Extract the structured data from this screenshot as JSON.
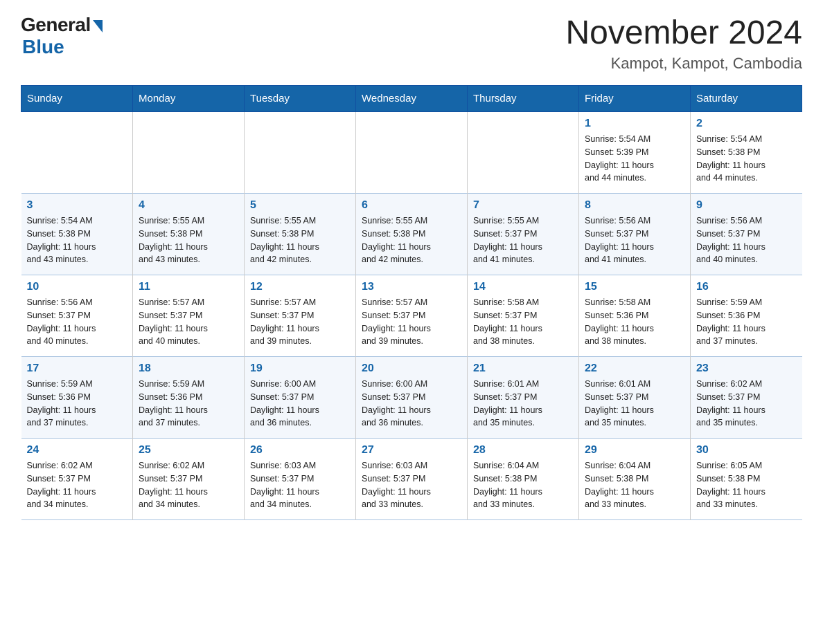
{
  "header": {
    "logo_general": "General",
    "logo_blue": "Blue",
    "main_title": "November 2024",
    "subtitle": "Kampot, Kampot, Cambodia"
  },
  "days_of_week": [
    "Sunday",
    "Monday",
    "Tuesday",
    "Wednesday",
    "Thursday",
    "Friday",
    "Saturday"
  ],
  "weeks": [
    [
      {
        "day": "",
        "info": ""
      },
      {
        "day": "",
        "info": ""
      },
      {
        "day": "",
        "info": ""
      },
      {
        "day": "",
        "info": ""
      },
      {
        "day": "",
        "info": ""
      },
      {
        "day": "1",
        "info": "Sunrise: 5:54 AM\nSunset: 5:39 PM\nDaylight: 11 hours\nand 44 minutes."
      },
      {
        "day": "2",
        "info": "Sunrise: 5:54 AM\nSunset: 5:38 PM\nDaylight: 11 hours\nand 44 minutes."
      }
    ],
    [
      {
        "day": "3",
        "info": "Sunrise: 5:54 AM\nSunset: 5:38 PM\nDaylight: 11 hours\nand 43 minutes."
      },
      {
        "day": "4",
        "info": "Sunrise: 5:55 AM\nSunset: 5:38 PM\nDaylight: 11 hours\nand 43 minutes."
      },
      {
        "day": "5",
        "info": "Sunrise: 5:55 AM\nSunset: 5:38 PM\nDaylight: 11 hours\nand 42 minutes."
      },
      {
        "day": "6",
        "info": "Sunrise: 5:55 AM\nSunset: 5:38 PM\nDaylight: 11 hours\nand 42 minutes."
      },
      {
        "day": "7",
        "info": "Sunrise: 5:55 AM\nSunset: 5:37 PM\nDaylight: 11 hours\nand 41 minutes."
      },
      {
        "day": "8",
        "info": "Sunrise: 5:56 AM\nSunset: 5:37 PM\nDaylight: 11 hours\nand 41 minutes."
      },
      {
        "day": "9",
        "info": "Sunrise: 5:56 AM\nSunset: 5:37 PM\nDaylight: 11 hours\nand 40 minutes."
      }
    ],
    [
      {
        "day": "10",
        "info": "Sunrise: 5:56 AM\nSunset: 5:37 PM\nDaylight: 11 hours\nand 40 minutes."
      },
      {
        "day": "11",
        "info": "Sunrise: 5:57 AM\nSunset: 5:37 PM\nDaylight: 11 hours\nand 40 minutes."
      },
      {
        "day": "12",
        "info": "Sunrise: 5:57 AM\nSunset: 5:37 PM\nDaylight: 11 hours\nand 39 minutes."
      },
      {
        "day": "13",
        "info": "Sunrise: 5:57 AM\nSunset: 5:37 PM\nDaylight: 11 hours\nand 39 minutes."
      },
      {
        "day": "14",
        "info": "Sunrise: 5:58 AM\nSunset: 5:37 PM\nDaylight: 11 hours\nand 38 minutes."
      },
      {
        "day": "15",
        "info": "Sunrise: 5:58 AM\nSunset: 5:36 PM\nDaylight: 11 hours\nand 38 minutes."
      },
      {
        "day": "16",
        "info": "Sunrise: 5:59 AM\nSunset: 5:36 PM\nDaylight: 11 hours\nand 37 minutes."
      }
    ],
    [
      {
        "day": "17",
        "info": "Sunrise: 5:59 AM\nSunset: 5:36 PM\nDaylight: 11 hours\nand 37 minutes."
      },
      {
        "day": "18",
        "info": "Sunrise: 5:59 AM\nSunset: 5:36 PM\nDaylight: 11 hours\nand 37 minutes."
      },
      {
        "day": "19",
        "info": "Sunrise: 6:00 AM\nSunset: 5:37 PM\nDaylight: 11 hours\nand 36 minutes."
      },
      {
        "day": "20",
        "info": "Sunrise: 6:00 AM\nSunset: 5:37 PM\nDaylight: 11 hours\nand 36 minutes."
      },
      {
        "day": "21",
        "info": "Sunrise: 6:01 AM\nSunset: 5:37 PM\nDaylight: 11 hours\nand 35 minutes."
      },
      {
        "day": "22",
        "info": "Sunrise: 6:01 AM\nSunset: 5:37 PM\nDaylight: 11 hours\nand 35 minutes."
      },
      {
        "day": "23",
        "info": "Sunrise: 6:02 AM\nSunset: 5:37 PM\nDaylight: 11 hours\nand 35 minutes."
      }
    ],
    [
      {
        "day": "24",
        "info": "Sunrise: 6:02 AM\nSunset: 5:37 PM\nDaylight: 11 hours\nand 34 minutes."
      },
      {
        "day": "25",
        "info": "Sunrise: 6:02 AM\nSunset: 5:37 PM\nDaylight: 11 hours\nand 34 minutes."
      },
      {
        "day": "26",
        "info": "Sunrise: 6:03 AM\nSunset: 5:37 PM\nDaylight: 11 hours\nand 34 minutes."
      },
      {
        "day": "27",
        "info": "Sunrise: 6:03 AM\nSunset: 5:37 PM\nDaylight: 11 hours\nand 33 minutes."
      },
      {
        "day": "28",
        "info": "Sunrise: 6:04 AM\nSunset: 5:38 PM\nDaylight: 11 hours\nand 33 minutes."
      },
      {
        "day": "29",
        "info": "Sunrise: 6:04 AM\nSunset: 5:38 PM\nDaylight: 11 hours\nand 33 minutes."
      },
      {
        "day": "30",
        "info": "Sunrise: 6:05 AM\nSunset: 5:38 PM\nDaylight: 11 hours\nand 33 minutes."
      }
    ]
  ]
}
